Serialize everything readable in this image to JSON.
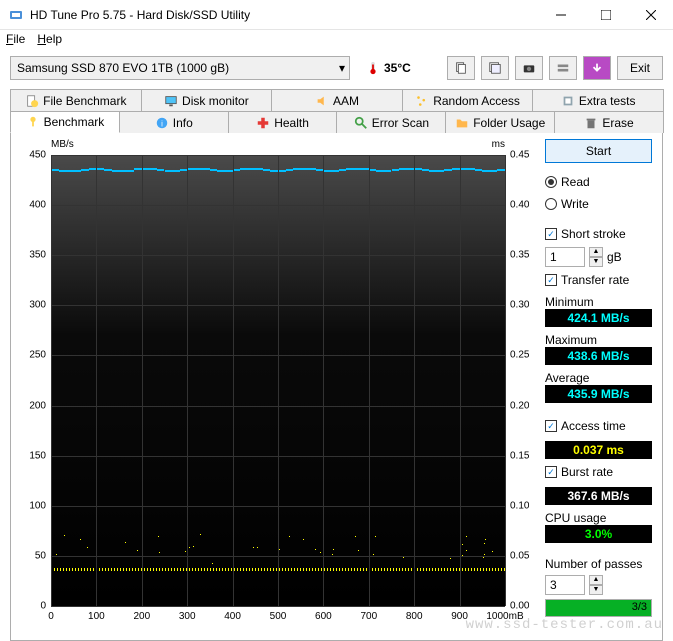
{
  "window": {
    "title": "HD Tune Pro 5.75 - Hard Disk/SSD Utility"
  },
  "menu": {
    "file": "File",
    "help": "Help"
  },
  "toolbar": {
    "drive": "Samsung SSD 870 EVO 1TB (1000 gB)",
    "temp": "35°C",
    "exit": "Exit"
  },
  "tabs_top": {
    "file_benchmark": "File Benchmark",
    "disk_monitor": "Disk monitor",
    "aam": "AAM",
    "random_access": "Random Access",
    "extra_tests": "Extra tests"
  },
  "tabs_bottom": {
    "benchmark": "Benchmark",
    "info": "Info",
    "health": "Health",
    "error_scan": "Error Scan",
    "folder_usage": "Folder Usage",
    "erase": "Erase"
  },
  "chart_data": {
    "type": "line",
    "y_left_unit": "MB/s",
    "y_right_unit": "ms",
    "y_left_ticks": [
      0,
      50,
      100,
      150,
      200,
      250,
      300,
      350,
      400,
      450
    ],
    "y_right_ticks": [
      0,
      0.05,
      0.1,
      0.15,
      0.2,
      0.25,
      0.3,
      0.35,
      0.4,
      0.45
    ],
    "x_ticks": [
      0,
      100,
      200,
      300,
      400,
      500,
      600,
      700,
      800,
      900,
      1000
    ],
    "x_unit": "mB",
    "series": [
      {
        "name": "Transfer rate",
        "color": "#00bfff",
        "approx_value": 436,
        "range_y": [
          424.1,
          438.6
        ]
      },
      {
        "name": "Access time",
        "color": "#ffff00",
        "approx_value": 0.037
      }
    ]
  },
  "side": {
    "start": "Start",
    "read": "Read",
    "write": "Write",
    "short_stroke": "Short stroke",
    "short_stroke_val": "1",
    "short_stroke_unit": "gB",
    "transfer_rate": "Transfer rate",
    "minimum_label": "Minimum",
    "minimum_value": "424.1 MB/s",
    "maximum_label": "Maximum",
    "maximum_value": "438.6 MB/s",
    "average_label": "Average",
    "average_value": "435.9 MB/s",
    "access_time": "Access time",
    "access_time_value": "0.037 ms",
    "burst_rate": "Burst rate",
    "burst_rate_value": "367.6 MB/s",
    "cpu_usage": "CPU usage",
    "cpu_usage_value": "3.0%",
    "passes_label": "Number of passes",
    "passes_value": "3",
    "passes_progress": "3/3"
  },
  "watermark": "www.ssd-tester.com.au"
}
